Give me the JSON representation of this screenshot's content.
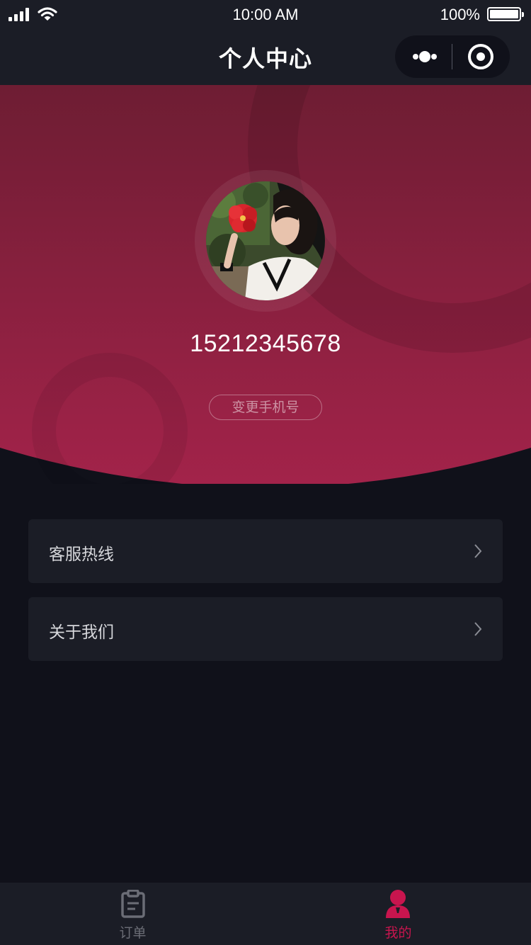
{
  "status_bar": {
    "time": "10:00 AM",
    "battery_percent": "100%",
    "battery_level": 1.0
  },
  "nav": {
    "title": "个人中心",
    "more_icon": "more-dots-icon",
    "close_icon": "target-circle-icon"
  },
  "profile": {
    "phone": "15212345678",
    "change_phone_label": "变更手机号"
  },
  "menu": {
    "items": [
      {
        "label": "客服热线",
        "icon": "chevron-right-icon"
      },
      {
        "label": "关于我们",
        "icon": "chevron-right-icon"
      }
    ]
  },
  "tabbar": {
    "tabs": [
      {
        "label": "订单",
        "icon": "clipboard-icon",
        "active": false
      },
      {
        "label": "我的",
        "icon": "user-icon",
        "active": true
      }
    ]
  },
  "colors": {
    "background": "#10111a",
    "surface": "#1b1d26",
    "accent": "#c8154e",
    "banner_top": "#6e1d33",
    "banner_bottom": "#a3234a",
    "inactive_tab": "#6b6d76"
  }
}
